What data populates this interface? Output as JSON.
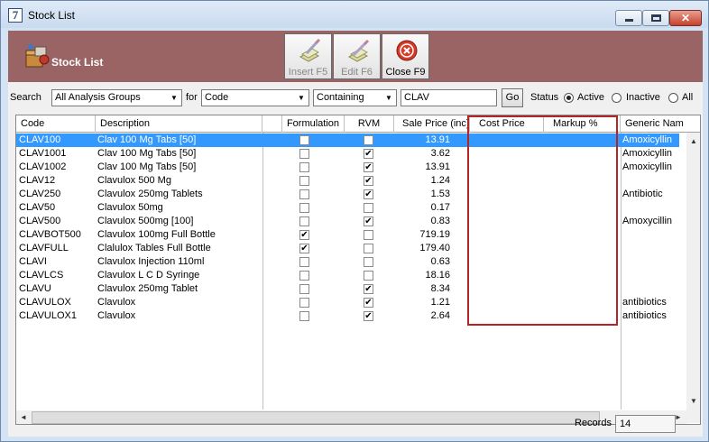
{
  "window": {
    "title": "Stock List",
    "app_icon_glyph": "7"
  },
  "header": {
    "title": "Stock List",
    "icon": "stock-boxes-icon"
  },
  "toolbar": [
    {
      "label": "Insert F5",
      "icon": "insert-icon",
      "enabled": false
    },
    {
      "label": "Edit F6",
      "icon": "edit-icon",
      "enabled": false
    },
    {
      "label": "Close F9",
      "icon": "close-circle-icon",
      "enabled": true
    }
  ],
  "filter": {
    "search_label": "Search",
    "group_value": "All Analysis Groups",
    "for_label": "for",
    "field_value": "Code",
    "mode_value": "Containing",
    "query_value": "CLAV",
    "go_label": "Go",
    "status_label": "Status",
    "status_options": [
      {
        "label": "Active",
        "selected": true
      },
      {
        "label": "Inactive",
        "selected": false
      },
      {
        "label": "All",
        "selected": false
      }
    ]
  },
  "grid": {
    "columns": [
      "Code",
      "Description",
      "",
      "Formulation",
      "RVM",
      "Sale Price (inc)",
      "Cost Price",
      "Markup %",
      "Generic Nam"
    ],
    "rows": [
      {
        "code": "CLAV100",
        "description": "Clav 100 Mg Tabs [50]",
        "formulation": false,
        "rvm": true,
        "sale_price": "13.91",
        "generic": "Amoxicyllin",
        "selected": true
      },
      {
        "code": "CLAV1001",
        "description": "Clav 100 Mg Tabs [50]",
        "formulation": false,
        "rvm": true,
        "sale_price": "3.62",
        "generic": "Amoxicyllin",
        "selected": false
      },
      {
        "code": "CLAV1002",
        "description": "Clav 100 Mg Tabs [50]",
        "formulation": false,
        "rvm": true,
        "sale_price": "13.91",
        "generic": "Amoxicyllin",
        "selected": false
      },
      {
        "code": "CLAV12",
        "description": "Clavulox 500 Mg",
        "formulation": false,
        "rvm": true,
        "sale_price": "1.24",
        "generic": "",
        "selected": false
      },
      {
        "code": "CLAV250",
        "description": "Clavulox 250mg Tablets",
        "formulation": false,
        "rvm": true,
        "sale_price": "1.53",
        "generic": "Antibiotic",
        "selected": false
      },
      {
        "code": "CLAV50",
        "description": "Clavulox 50mg",
        "formulation": false,
        "rvm": false,
        "sale_price": "0.17",
        "generic": "",
        "selected": false
      },
      {
        "code": "CLAV500",
        "description": "Clavulox 500mg [100]",
        "formulation": false,
        "rvm": true,
        "sale_price": "0.83",
        "generic": "Amoxycillin",
        "selected": false
      },
      {
        "code": "CLAVBOT500",
        "description": "Clavulox 100mg Full Bottle",
        "formulation": true,
        "rvm": false,
        "sale_price": "719.19",
        "generic": "",
        "selected": false
      },
      {
        "code": "CLAVFULL",
        "description": "Clalulox Tables Full Bottle",
        "formulation": true,
        "rvm": false,
        "sale_price": "179.40",
        "generic": "",
        "selected": false
      },
      {
        "code": "CLAVI",
        "description": "Clavulox Injection 110ml",
        "formulation": false,
        "rvm": false,
        "sale_price": "0.63",
        "generic": "",
        "selected": false
      },
      {
        "code": "CLAVLCS",
        "description": "Clavulox L C D Syringe",
        "formulation": false,
        "rvm": false,
        "sale_price": "18.16",
        "generic": "",
        "selected": false
      },
      {
        "code": "CLAVU",
        "description": "Clavulox 250mg Tablet",
        "formulation": false,
        "rvm": true,
        "sale_price": "8.34",
        "generic": "",
        "selected": false
      },
      {
        "code": "CLAVULOX",
        "description": "Clavulox",
        "formulation": false,
        "rvm": true,
        "sale_price": "1.21",
        "generic": "antibiotics",
        "selected": false
      },
      {
        "code": "CLAVULOX1",
        "description": "Clavulox",
        "formulation": false,
        "rvm": true,
        "sale_price": "2.64",
        "generic": "antibiotics",
        "selected": false
      }
    ]
  },
  "records": {
    "label": "Records",
    "value": "14"
  },
  "colors": {
    "header_bg": "#9a6464",
    "selection": "#3399ff",
    "highlight_box": "#b42525"
  }
}
